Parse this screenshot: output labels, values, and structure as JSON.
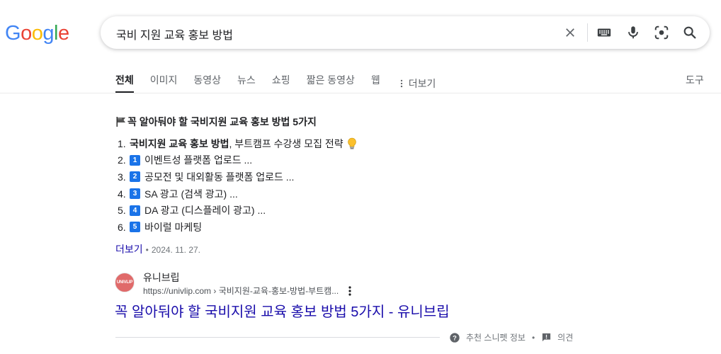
{
  "logo": {
    "letters": [
      "G",
      "o",
      "o",
      "g",
      "l",
      "e"
    ],
    "colors": [
      "#4285F4",
      "#EA4335",
      "#FBBC05",
      "#4285F4",
      "#34A853",
      "#EA4335"
    ]
  },
  "search": {
    "query": "국비 지원 교육 홍보 방법"
  },
  "icons": {
    "clear": "close-icon",
    "keyboard": "keyboard-icon",
    "voice": "microphone-icon",
    "lens": "camera-lens-icon",
    "search": "search-icon"
  },
  "tabs": [
    {
      "label": "전체",
      "active": true
    },
    {
      "label": "이미지"
    },
    {
      "label": "동영상"
    },
    {
      "label": "뉴스"
    },
    {
      "label": "쇼핑"
    },
    {
      "label": "짧은 동영상"
    },
    {
      "label": "웹"
    }
  ],
  "more_tab": "더보기",
  "tools": "도구",
  "snippet": {
    "title": "꼭 알아둬야 할 국비지원 교육 홍보 방법 5가지",
    "items": [
      {
        "num": "1.",
        "bold": "국비지원 교육 홍보 방법",
        "text": ", 부트캠프 수강생 모집 전략"
      },
      {
        "num": "2.",
        "badge": "1",
        "text": "이벤트성 플랫폼 업로드 ..."
      },
      {
        "num": "3.",
        "badge": "2",
        "text": "공모전 및 대외활동 플랫폼 업로드 ..."
      },
      {
        "num": "4.",
        "badge": "3",
        "text": "SA 광고 (검색 광고) ..."
      },
      {
        "num": "5.",
        "badge": "4",
        "text": "DA 광고 (디스플레이 광고) ..."
      },
      {
        "num": "6.",
        "badge": "5",
        "text": "바이럴 마케팅"
      }
    ],
    "more": "더보기",
    "date": "2024. 11. 27."
  },
  "result": {
    "favicon_text": "UNIVLIP",
    "site": "유니브립",
    "url": "https://univlip.com",
    "breadcrumb": "› 국비지원-교육-홍보-방법-부트캠...",
    "title": "꼭 알아둬야 할 국비지원 교육 홍보 방법 5가지 - 유니브립"
  },
  "footer": {
    "about": "추천 스니펫 정보",
    "feedback": "의견"
  }
}
